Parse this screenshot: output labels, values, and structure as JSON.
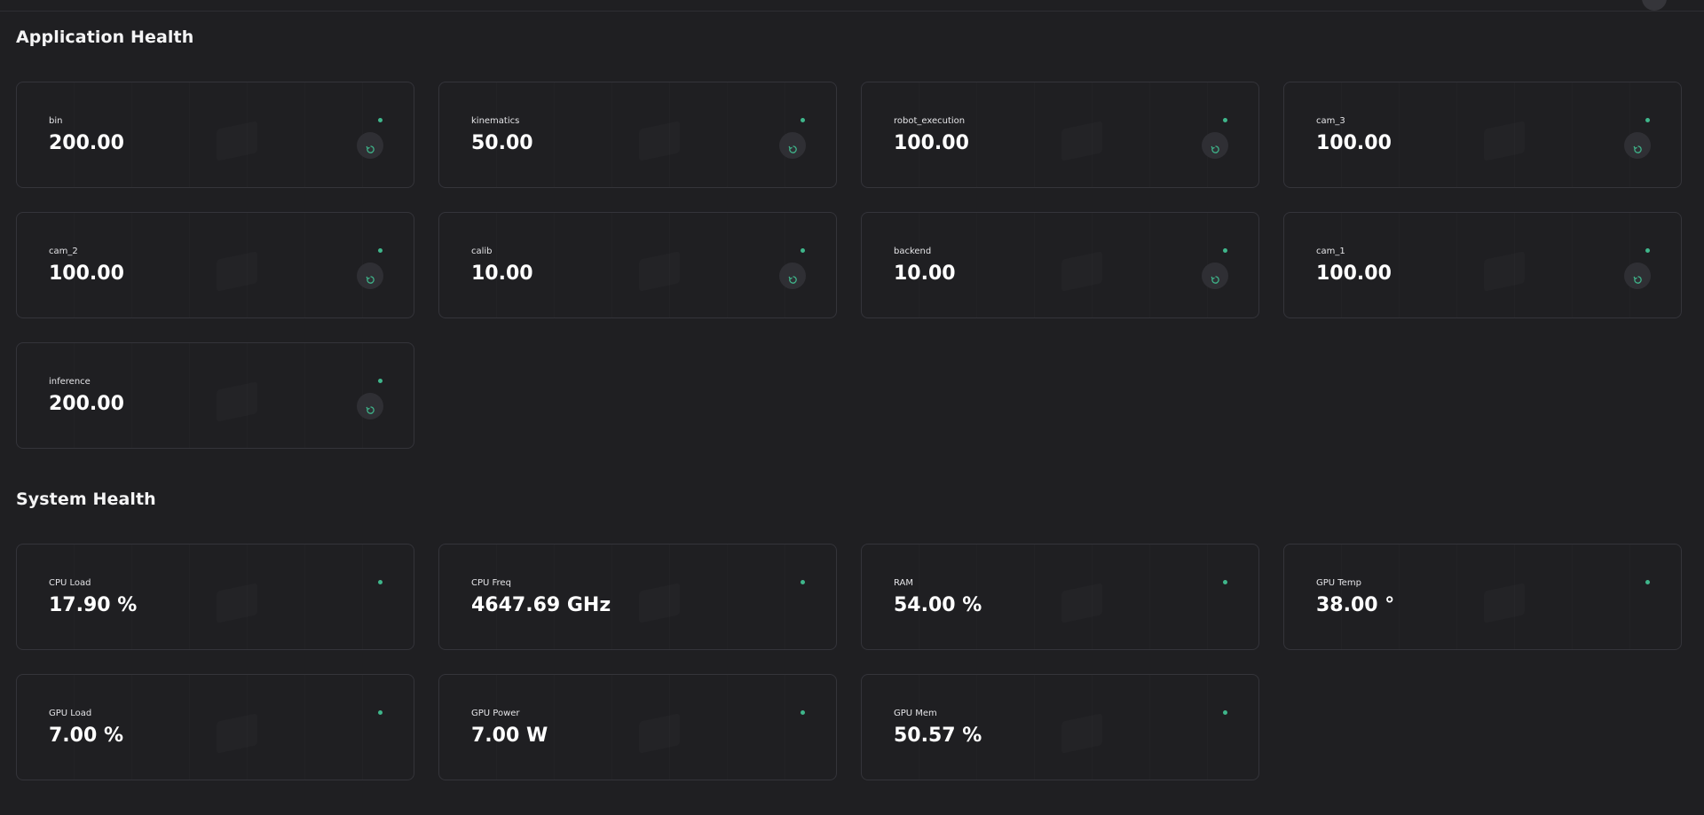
{
  "application_health": {
    "title": "Application Health",
    "items": [
      {
        "name": "bin",
        "value": "200.00"
      },
      {
        "name": "kinematics",
        "value": "50.00"
      },
      {
        "name": "robot_execution",
        "value": "100.00"
      },
      {
        "name": "cam_3",
        "value": "100.00"
      },
      {
        "name": "cam_2",
        "value": "100.00"
      },
      {
        "name": "calib",
        "value": "10.00"
      },
      {
        "name": "backend",
        "value": "10.00"
      },
      {
        "name": "cam_1",
        "value": "100.00"
      },
      {
        "name": "inference",
        "value": "200.00"
      }
    ]
  },
  "system_health": {
    "title": "System Health",
    "items": [
      {
        "name": "CPU Load",
        "value": "17.90 %"
      },
      {
        "name": "CPU Freq",
        "value": "4647.69 GHz"
      },
      {
        "name": "RAM",
        "value": "54.00 %"
      },
      {
        "name": "GPU Temp",
        "value": "38.00 °"
      },
      {
        "name": "GPU Load",
        "value": "7.00 %"
      },
      {
        "name": "GPU Power",
        "value": "7.00 W"
      },
      {
        "name": "GPU Mem",
        "value": "50.57 %"
      }
    ]
  },
  "colors": {
    "background": "#1f1f22",
    "card_border": "#34343a",
    "status_ok": "#3fb68b",
    "button_bg": "#2f2f34"
  },
  "icons": {
    "status": "status-dot-icon",
    "restart": "restart-icon"
  }
}
